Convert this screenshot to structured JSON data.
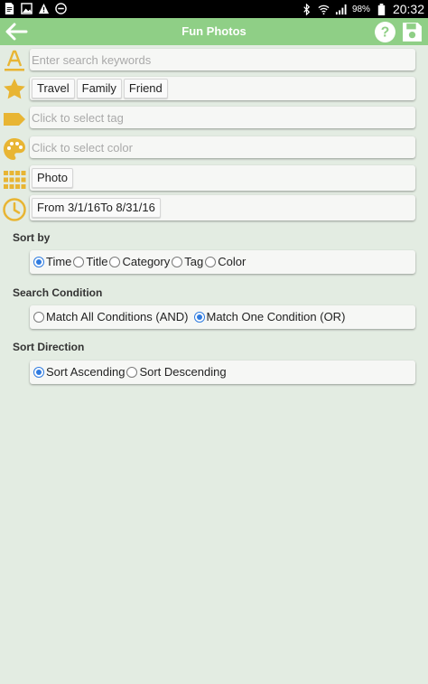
{
  "status_bar": {
    "battery": "98%",
    "time": "20:32"
  },
  "toolbar": {
    "title": "Fun Photos"
  },
  "search": {
    "placeholder": "Enter search keywords"
  },
  "category": {
    "chips": [
      "Travel",
      "Family",
      "Friend"
    ]
  },
  "tag": {
    "placeholder": "Click to select tag"
  },
  "color": {
    "placeholder": "Click to select color"
  },
  "type": {
    "chips": [
      "Photo"
    ]
  },
  "date": {
    "chips": [
      "From 3/1/16To 8/31/16"
    ]
  },
  "sort_by": {
    "label": "Sort by",
    "options": [
      "Time",
      "Title",
      "Category",
      "Tag",
      "Color"
    ],
    "selected": "Time"
  },
  "search_condition": {
    "label": "Search Condition",
    "options": [
      "Match All Conditions (AND)",
      "Match One Condition (OR)"
    ],
    "selected": "Match One Condition (OR)"
  },
  "sort_direction": {
    "label": "Sort Direction",
    "options": [
      "Sort Ascending",
      "Sort Descending"
    ],
    "selected": "Sort Ascending"
  },
  "colors": {
    "toolbar": "#8fcf86",
    "icon_accent": "#e8b533",
    "background": "#e3ece2",
    "radio_selected": "#2f7be0"
  }
}
